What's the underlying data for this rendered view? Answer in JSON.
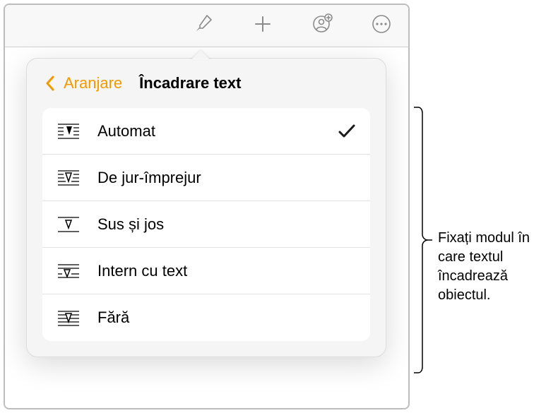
{
  "toolbar": {
    "format_icon": "paintbrush",
    "insert_icon": "plus",
    "collaborate_icon": "person-circle-plus",
    "more_icon": "ellipsis-circle"
  },
  "popover": {
    "back_label": "Aranjare",
    "title": "Încadrare text",
    "selected_index": 0,
    "options": [
      {
        "label": "Automat"
      },
      {
        "label": "De jur-împrejur"
      },
      {
        "label": "Sus și jos"
      },
      {
        "label": "Intern cu text"
      },
      {
        "label": "Fără"
      }
    ]
  },
  "callout": {
    "text": "Fixați modul în care textul încadrează obiectul."
  }
}
